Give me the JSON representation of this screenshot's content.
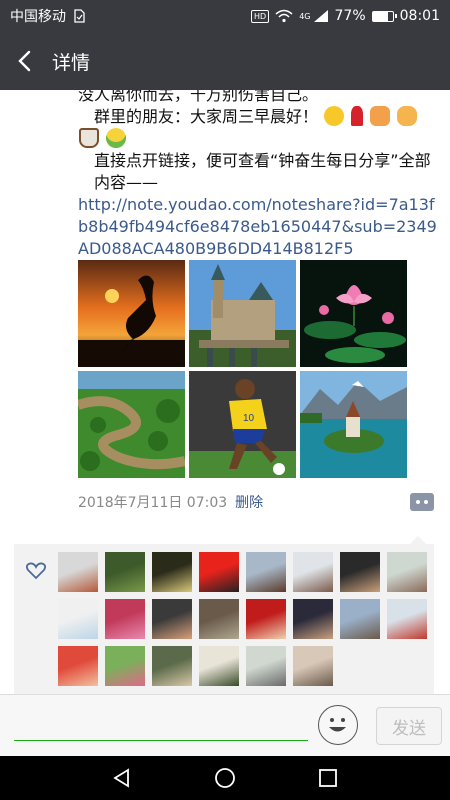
{
  "status_bar": {
    "carrier": "中国移动",
    "hd": "HD",
    "network": "4G",
    "battery_percent": "77%",
    "battery_level": 0.77,
    "time": "08:01"
  },
  "header": {
    "title": "详情"
  },
  "post": {
    "line_partial": "没人离你而去，千万别伤害自己。",
    "greeting": "群里的朋友：大家周三早晨好！",
    "instruction": "直接点开链接，便可查看“钟奋生每日分享”全部内容——",
    "link": "http://note.youdao.com/noteshare?id=7a13fb8b49fb494cf6e8478eb1650447&sub=2349AD088ACA480B9B6DD414B812F5",
    "timestamp": "2018年7月11日 07:03",
    "delete_label": "删除"
  },
  "images": [
    {
      "name": "sunset-bird"
    },
    {
      "name": "castle"
    },
    {
      "name": "lotus"
    },
    {
      "name": "river-forest"
    },
    {
      "name": "soccer-player"
    },
    {
      "name": "lake-island"
    }
  ],
  "likes": {
    "avatars_row1": 8,
    "avatars_row2": 8,
    "avatars_row3": 6
  },
  "input_bar": {
    "placeholder": "",
    "send_label": "发送"
  },
  "colors": {
    "header_bg": "#393a3f",
    "link": "#3b5a8c",
    "accent_green": "#1aad19"
  }
}
